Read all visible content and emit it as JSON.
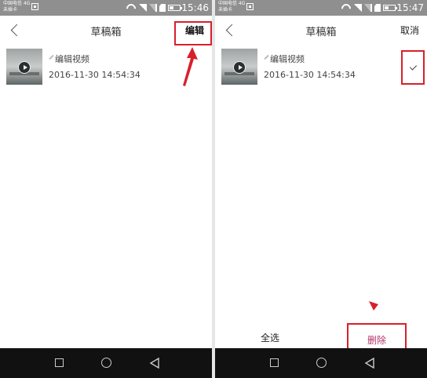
{
  "status_bar": {
    "carrier_line1": "中国电信 4G",
    "carrier_line2": "未插卡"
  },
  "screen_left": {
    "clock": "15:46",
    "title": "草稿箱",
    "edit_label": "编辑",
    "draft": {
      "title": "编辑视频",
      "time": "2016-11-30 14:54:34"
    }
  },
  "screen_right": {
    "clock": "15:47",
    "title": "草稿箱",
    "cancel_label": "取消",
    "draft": {
      "title": "编辑视频",
      "time": "2016-11-30 14:54:34"
    },
    "select_all_label": "全选",
    "delete_label": "删除"
  },
  "colors": {
    "annotation_red": "#d8202a",
    "delete_text": "#b4346a",
    "navbar": "#111111"
  }
}
